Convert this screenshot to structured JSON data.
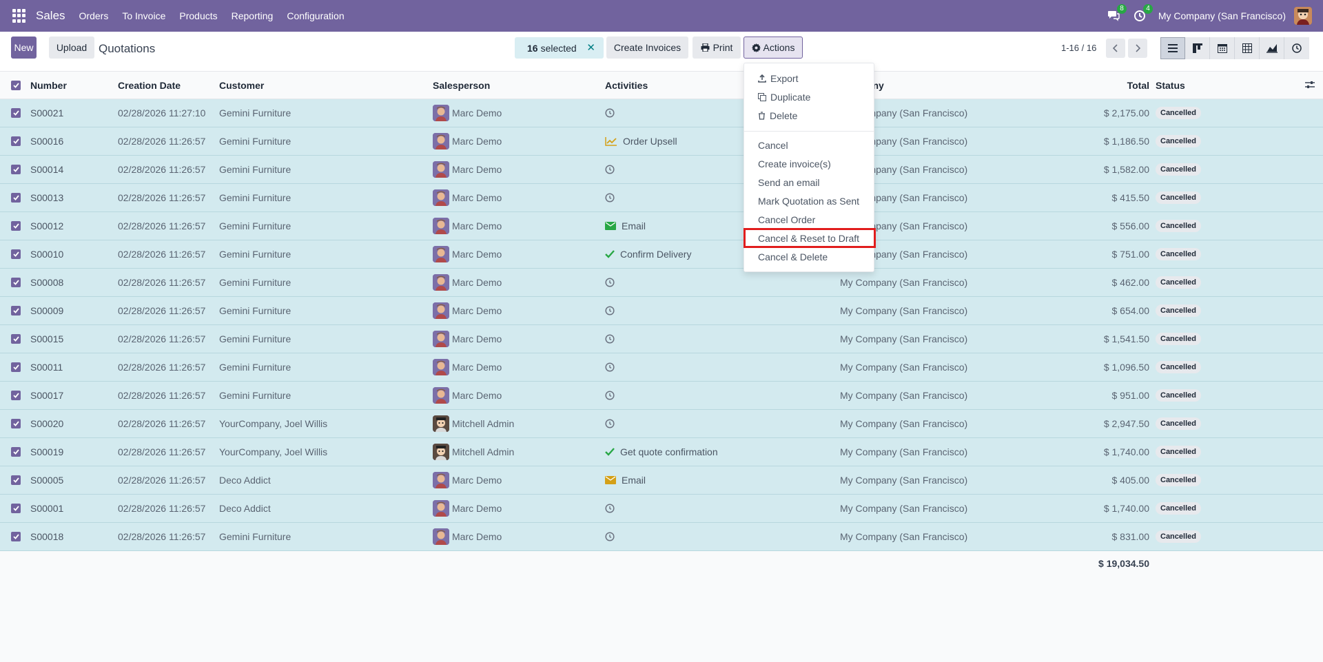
{
  "navbar": {
    "app_name": "Sales",
    "menu": [
      "Orders",
      "To Invoice",
      "Products",
      "Reporting",
      "Configuration"
    ],
    "messages_count": "8",
    "activities_count": "4",
    "company": "My Company (San Francisco)"
  },
  "control_panel": {
    "new_label": "New",
    "upload_label": "Upload",
    "title": "Quotations",
    "selected_count": "16",
    "selected_text": "selected",
    "create_invoices_label": "Create Invoices",
    "print_label": "Print",
    "actions_label": "Actions",
    "pager": "1-16 / 16"
  },
  "table": {
    "headers": {
      "number": "Number",
      "date": "Creation Date",
      "customer": "Customer",
      "salesperson": "Salesperson",
      "activities": "Activities",
      "company": "Company",
      "total": "Total",
      "status": "Status"
    },
    "rows": [
      {
        "number": "S00021",
        "date": "02/28/2026 11:27:10",
        "customer": "Gemini Furniture",
        "salesperson": "Marc Demo",
        "activity": "",
        "activity_icon": "clock-icon",
        "company": "My Company (San Francisco)",
        "total": "$ 2,175.00",
        "status": "Cancelled"
      },
      {
        "number": "S00016",
        "date": "02/28/2026 11:26:57",
        "customer": "Gemini Furniture",
        "salesperson": "Marc Demo",
        "activity": "Order Upsell",
        "activity_icon": "chart-up-icon",
        "company": "My Company (San Francisco)",
        "total": "$ 1,186.50",
        "status": "Cancelled"
      },
      {
        "number": "S00014",
        "date": "02/28/2026 11:26:57",
        "customer": "Gemini Furniture",
        "salesperson": "Marc Demo",
        "activity": "",
        "activity_icon": "clock-icon",
        "company": "My Company (San Francisco)",
        "total": "$ 1,582.00",
        "status": "Cancelled"
      },
      {
        "number": "S00013",
        "date": "02/28/2026 11:26:57",
        "customer": "Gemini Furniture",
        "salesperson": "Marc Demo",
        "activity": "",
        "activity_icon": "clock-icon",
        "company": "My Company (San Francisco)",
        "total": "$ 415.50",
        "status": "Cancelled"
      },
      {
        "number": "S00012",
        "date": "02/28/2026 11:26:57",
        "customer": "Gemini Furniture",
        "salesperson": "Marc Demo",
        "activity": "Email",
        "activity_icon": "email-green-icon",
        "company": "My Company (San Francisco)",
        "total": "$ 556.00",
        "status": "Cancelled"
      },
      {
        "number": "S00010",
        "date": "02/28/2026 11:26:57",
        "customer": "Gemini Furniture",
        "salesperson": "Marc Demo",
        "activity": "Confirm Delivery",
        "activity_icon": "check-icon",
        "company": "My Company (San Francisco)",
        "total": "$ 751.00",
        "status": "Cancelled"
      },
      {
        "number": "S00008",
        "date": "02/28/2026 11:26:57",
        "customer": "Gemini Furniture",
        "salesperson": "Marc Demo",
        "activity": "",
        "activity_icon": "clock-icon",
        "company": "My Company (San Francisco)",
        "total": "$ 462.00",
        "status": "Cancelled"
      },
      {
        "number": "S00009",
        "date": "02/28/2026 11:26:57",
        "customer": "Gemini Furniture",
        "salesperson": "Marc Demo",
        "activity": "",
        "activity_icon": "clock-icon",
        "company": "My Company (San Francisco)",
        "total": "$ 654.00",
        "status": "Cancelled"
      },
      {
        "number": "S00015",
        "date": "02/28/2026 11:26:57",
        "customer": "Gemini Furniture",
        "salesperson": "Marc Demo",
        "activity": "",
        "activity_icon": "clock-icon",
        "company": "My Company (San Francisco)",
        "total": "$ 1,541.50",
        "status": "Cancelled"
      },
      {
        "number": "S00011",
        "date": "02/28/2026 11:26:57",
        "customer": "Gemini Furniture",
        "salesperson": "Marc Demo",
        "activity": "",
        "activity_icon": "clock-icon",
        "company": "My Company (San Francisco)",
        "total": "$ 1,096.50",
        "status": "Cancelled"
      },
      {
        "number": "S00017",
        "date": "02/28/2026 11:26:57",
        "customer": "Gemini Furniture",
        "salesperson": "Marc Demo",
        "activity": "",
        "activity_icon": "clock-icon",
        "company": "My Company (San Francisco)",
        "total": "$ 951.00",
        "status": "Cancelled"
      },
      {
        "number": "S00020",
        "date": "02/28/2026 11:26:57",
        "customer": "YourCompany, Joel Willis",
        "salesperson": "Mitchell Admin",
        "activity": "",
        "activity_icon": "clock-icon",
        "company": "My Company (San Francisco)",
        "total": "$ 2,947.50",
        "status": "Cancelled"
      },
      {
        "number": "S00019",
        "date": "02/28/2026 11:26:57",
        "customer": "YourCompany, Joel Willis",
        "salesperson": "Mitchell Admin",
        "activity": "Get quote confirmation",
        "activity_icon": "check-icon",
        "company": "My Company (San Francisco)",
        "total": "$ 1,740.00",
        "status": "Cancelled"
      },
      {
        "number": "S00005",
        "date": "02/28/2026 11:26:57",
        "customer": "Deco Addict",
        "salesperson": "Marc Demo",
        "activity": "Email",
        "activity_icon": "email-orange-icon",
        "company": "My Company (San Francisco)",
        "total": "$ 405.00",
        "status": "Cancelled"
      },
      {
        "number": "S00001",
        "date": "02/28/2026 11:26:57",
        "customer": "Deco Addict",
        "salesperson": "Marc Demo",
        "activity": "",
        "activity_icon": "clock-icon",
        "company": "My Company (San Francisco)",
        "total": "$ 1,740.00",
        "status": "Cancelled"
      },
      {
        "number": "S00018",
        "date": "02/28/2026 11:26:57",
        "customer": "Gemini Furniture",
        "salesperson": "Marc Demo",
        "activity": "",
        "activity_icon": "clock-icon",
        "company": "My Company (San Francisco)",
        "total": "$ 831.00",
        "status": "Cancelled"
      }
    ],
    "grand_total": "$ 19,034.50"
  },
  "actions_menu": {
    "items": [
      "Export",
      "Duplicate",
      "Delete",
      "Cancel",
      "Create invoice(s)",
      "Send an email",
      "Mark Quotation as Sent",
      "Cancel Order",
      "Cancel & Reset to Draft",
      "Cancel & Delete"
    ],
    "highlighted": "Cancel & Reset to Draft"
  },
  "colors": {
    "brand": "#71639e",
    "selected_row": "#d3eaef",
    "highlight_outline": "#e11d1d"
  }
}
